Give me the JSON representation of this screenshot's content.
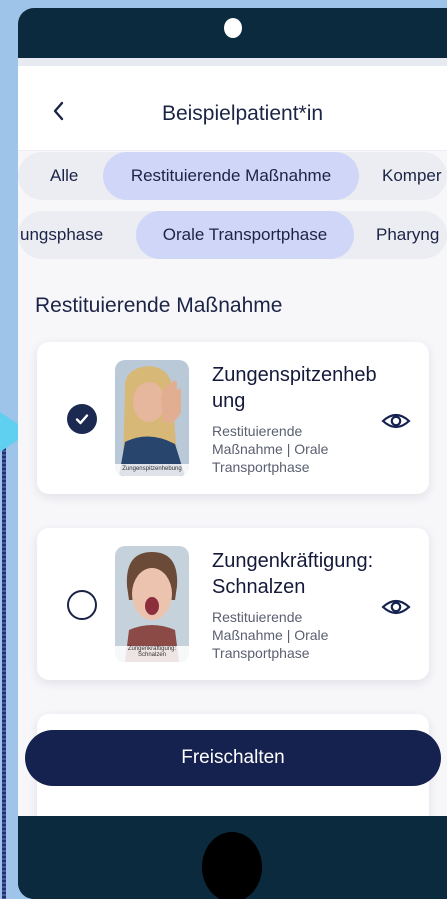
{
  "header": {
    "title": "Beispielpatient*in"
  },
  "filter_row_1": [
    {
      "label": "Alle",
      "active": false
    },
    {
      "label": "Restituierende Maßnahme",
      "active": true
    },
    {
      "label": "Komper",
      "active": false
    }
  ],
  "filter_row_2": [
    {
      "label": "ungsphase",
      "active": false
    },
    {
      "label": "Orale Transportphase",
      "active": true
    },
    {
      "label": "Pharyng",
      "active": false
    }
  ],
  "section": {
    "title": "Restituierende Maßnahme"
  },
  "exercises": [
    {
      "title": "Zungenspitzenheb ung",
      "subtitle": "Restituierende Maßnahme | Orale Transportphase",
      "thumb_caption": "Zungenspitzenhebung",
      "selected": true
    },
    {
      "title": "Zungenkräftigung: Schnalzen",
      "subtitle": "Restituierende Maßnahme | Orale Transportphase",
      "thumb_caption": "Zungenkräftigung: Schnalzen",
      "selected": false
    }
  ],
  "actions": {
    "unlock_label": "Freischalten"
  },
  "colors": {
    "navy": "#15224f",
    "active_chip": "#cfd6f7",
    "bezel": "#0b2a3d",
    "arrow": "#5fd0ef"
  },
  "icons": {
    "back": "chevron-left-icon",
    "check": "check-icon",
    "view": "eye-icon"
  }
}
